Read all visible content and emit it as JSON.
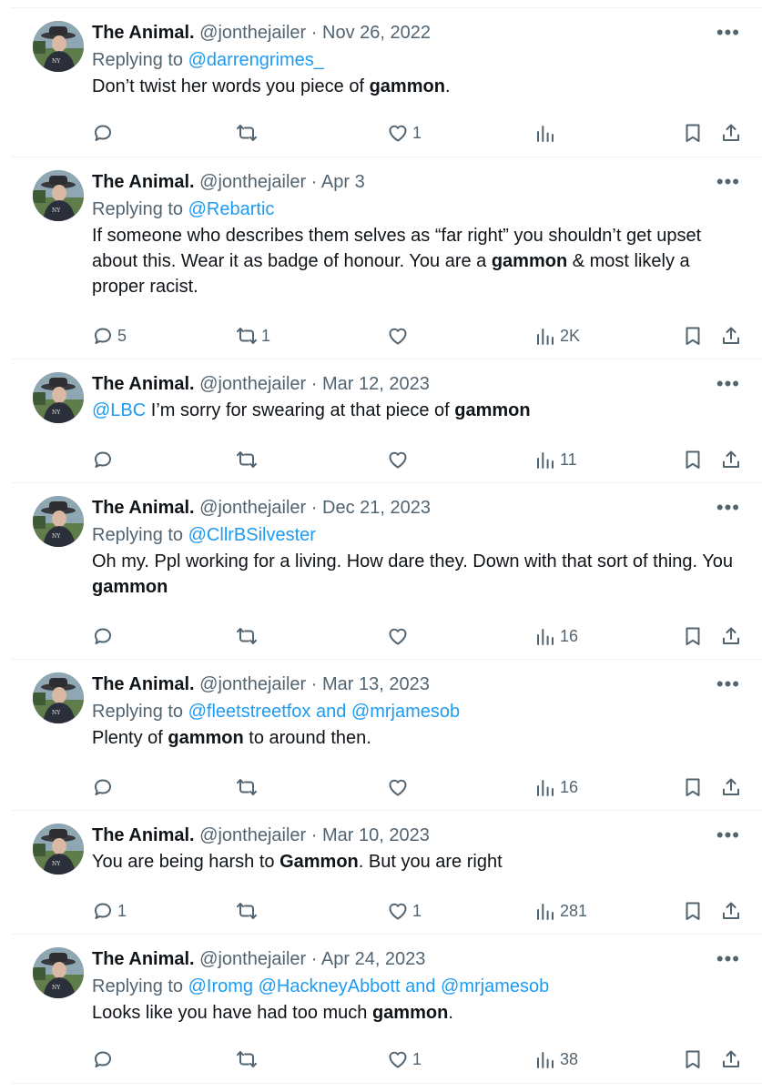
{
  "tweets": [
    {
      "name": "The Animal.",
      "handle": "@jonthejailer",
      "date": "Nov 26, 2022",
      "reply_label": "Replying to",
      "reply_to": "@darrengrimes_",
      "text_parts": [
        {
          "t": "Don’t twist her words you piece of "
        },
        {
          "t": "gammon",
          "b": true
        },
        {
          "t": "."
        }
      ],
      "replies": "",
      "retweets": "",
      "likes": "1",
      "views": ""
    },
    {
      "name": "The Animal.",
      "handle": "@jonthejailer",
      "date": "Apr 3",
      "reply_label": "Replying to",
      "reply_to": "@Rebartic",
      "text_parts": [
        {
          "t": "If someone who describes them selves as “far right” you shouldn’t get upset about this. Wear it as badge of honour. You are a "
        },
        {
          "t": "gammon",
          "b": true
        },
        {
          "t": " & most likely a proper racist."
        }
      ],
      "replies": "5",
      "retweets": "1",
      "likes": "",
      "views": "2K"
    },
    {
      "name": "The Animal.",
      "handle": "@jonthejailer",
      "date": "Mar 12, 2023",
      "reply_label": "",
      "reply_to": "",
      "text_parts": [
        {
          "t": "@LBC",
          "l": true
        },
        {
          "t": " I’m sorry for swearing at that piece of "
        },
        {
          "t": "gammon",
          "b": true
        }
      ],
      "replies": "",
      "retweets": "",
      "likes": "",
      "views": "11"
    },
    {
      "name": "The Animal.",
      "handle": "@jonthejailer",
      "date": "Dec 21, 2023",
      "reply_label": "Replying to",
      "reply_to": "@CllrBSilvester",
      "text_parts": [
        {
          "t": "Oh my. Ppl working for a living. How dare they. Down with that sort of thing. You "
        },
        {
          "t": "gammon",
          "b": true
        }
      ],
      "replies": "",
      "retweets": "",
      "likes": "",
      "views": "16"
    },
    {
      "name": "The Animal.",
      "handle": "@jonthejailer",
      "date": "Mar 13, 2023",
      "reply_label": "Replying to",
      "reply_to": "@fleetstreetfox and @mrjamesob",
      "text_parts": [
        {
          "t": "Plenty of "
        },
        {
          "t": "gammon",
          "b": true
        },
        {
          "t": " to around then."
        }
      ],
      "replies": "",
      "retweets": "",
      "likes": "",
      "views": "16"
    },
    {
      "name": "The Animal.",
      "handle": "@jonthejailer",
      "date": "Mar 10, 2023",
      "reply_label": "",
      "reply_to": "",
      "text_parts": [
        {
          "t": "You are being harsh to "
        },
        {
          "t": "Gammon",
          "b": true
        },
        {
          "t": ". But you are right"
        }
      ],
      "replies": "1",
      "retweets": "",
      "likes": "1",
      "views": "281"
    },
    {
      "name": "The Animal.",
      "handle": "@jonthejailer",
      "date": "Apr 24, 2023",
      "reply_label": "Replying to",
      "reply_to": "@Iromg @HackneyAbbott and @mrjamesob",
      "text_parts": [
        {
          "t": "Looks like you have had too much "
        },
        {
          "t": "gammon",
          "b": true
        },
        {
          "t": "."
        }
      ],
      "replies": "",
      "retweets": "",
      "likes": "1",
      "views": "38"
    }
  ],
  "separator": "·",
  "more_icon": "more-horizontal-icon",
  "icons": [
    "reply-icon",
    "retweet-icon",
    "like-icon",
    "views-icon",
    "bookmark-icon",
    "share-icon"
  ],
  "colors": {
    "link": "#1d9bf0",
    "muted": "#536471",
    "text": "#0f1419",
    "border": "#eff3f4"
  }
}
